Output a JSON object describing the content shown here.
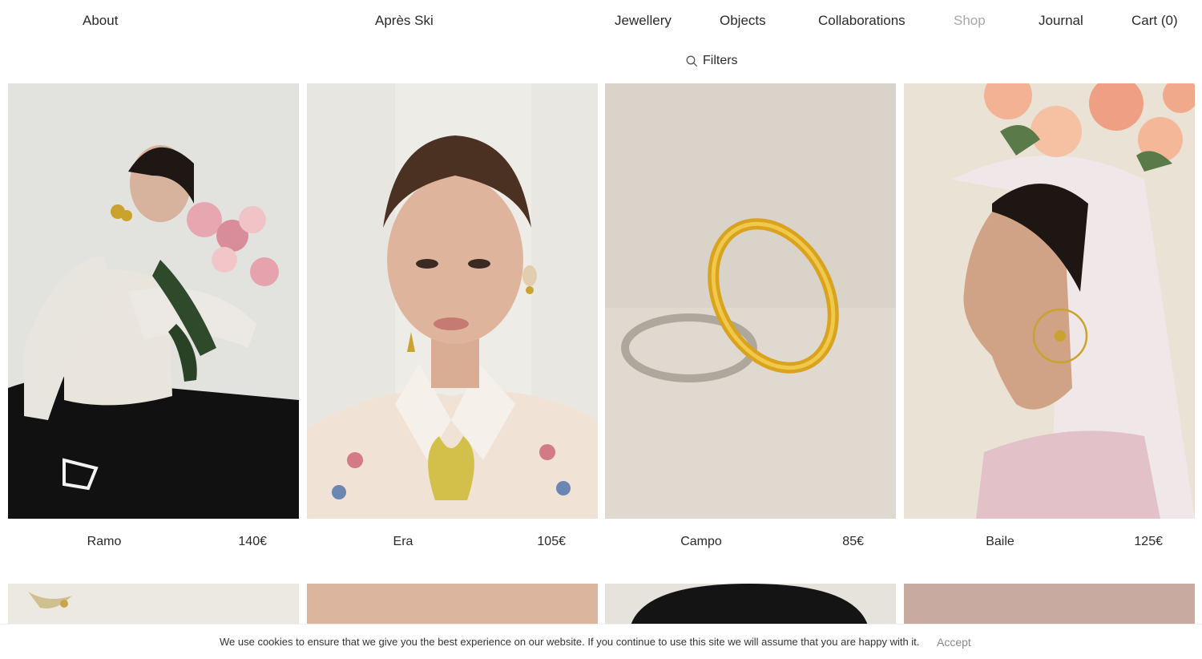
{
  "nav": {
    "about": "About",
    "brand": "Après Ski",
    "jewellery": "Jewellery",
    "objects": "Objects",
    "collaborations": "Collaborations",
    "shop": "Shop",
    "journal": "Journal",
    "cart": "Cart (0)"
  },
  "filters": {
    "label": "Filters",
    "icon": "search-icon"
  },
  "products": [
    {
      "name": "Ramo",
      "price": "140€"
    },
    {
      "name": "Era",
      "price": "105€"
    },
    {
      "name": "Campo",
      "price": "85€"
    },
    {
      "name": "Baile",
      "price": "125€"
    }
  ],
  "cookie": {
    "message": "We use cookies to ensure that we give you the best experience on our website. If you continue to use this site we will assume that you are happy with it.",
    "accept": "Accept"
  },
  "colors": {
    "active_nav": "#a7a7a7",
    "text": "#2a2a2a"
  }
}
